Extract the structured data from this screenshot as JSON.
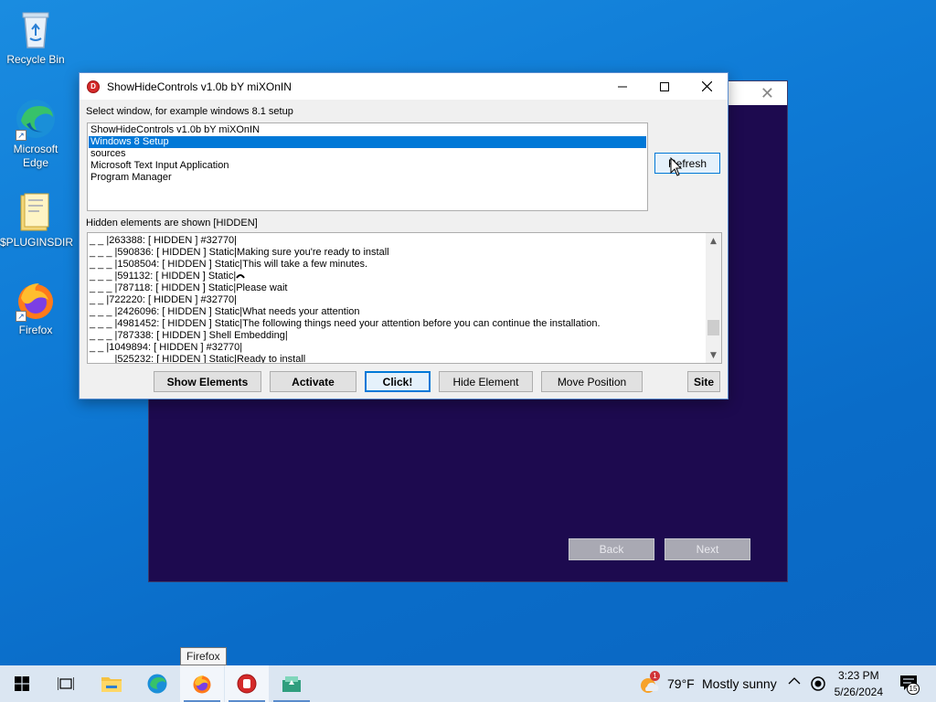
{
  "desktop": {
    "icons": [
      {
        "label": "Recycle Bin"
      },
      {
        "label": "Microsoft Edge"
      },
      {
        "label": "$PLUGINSDIR"
      },
      {
        "label": "Firefox"
      }
    ]
  },
  "setup_window": {
    "back_label": "Back",
    "next_label": "Next"
  },
  "dialog": {
    "title": "ShowHideControls v1.0b bY miXOnIN",
    "select_label": "Select window, for example windows 8.1 setup",
    "windows_list": [
      "ShowHideControls v1.0b bY miXOnIN",
      "Windows 8 Setup",
      "sources",
      "Microsoft Text Input Application",
      "Program Manager"
    ],
    "selected_window": "Windows 8 Setup",
    "refresh_label": "Refresh",
    "hidden_label": "Hidden elements are shown [HIDDEN]",
    "elements_lines": [
      "_ _ |263388: [ HIDDEN ] #32770|",
      "_ _ _ |590836: [ HIDDEN ] Static|Making sure you're ready to install",
      "_ _ _ |1508504: [ HIDDEN ] Static|This will take a few minutes.",
      "_ _ _ |591132: [ HIDDEN ] Static|",
      "_ _ _ |787118: [ HIDDEN ] Static|Please wait",
      "_ _ |722220: [ HIDDEN ] #32770|",
      "_ _ _ |2426096: [ HIDDEN ] Static|What needs your attention",
      "_ _ _ |4981452: [ HIDDEN ] Static|The following things need your attention before you can continue the installation.",
      "_ _ _ |787338: [ HIDDEN ] Shell Embedding|",
      "_ _ |1049894: [ HIDDEN ] #32770|",
      "_ _ _ |525232: [ HIDDEN ] Static|Ready to install"
    ],
    "buttons": {
      "show_elements": "Show Elements",
      "activate": "Activate",
      "click": "Click!",
      "hide_element": "Hide Element",
      "move_position": "Move Position",
      "site": "Site"
    }
  },
  "tooltip": "Firefox",
  "taskbar": {
    "weather_temp": "79°F",
    "weather_text": "Mostly sunny",
    "weather_badge": "1",
    "time": "3:23 PM",
    "date": "5/26/2024",
    "notification_count": "15"
  },
  "colors": {
    "desktop_bg": "#0f7bd6",
    "selection": "#0078d7",
    "setup_bg": "#1d0a4f",
    "taskbar_bg": "#dbe6f2"
  }
}
